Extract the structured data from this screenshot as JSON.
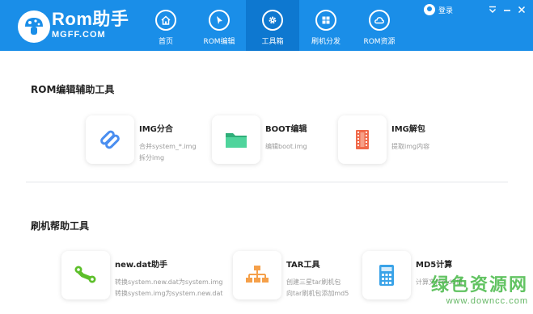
{
  "header": {
    "brand_name": "Rom助手",
    "brand_sub": "MGFF.COM",
    "login_label": "登录",
    "colors": {
      "bar": "#1a8ee8",
      "active_tab": "#0e78d0"
    },
    "nav": [
      {
        "label": "首页",
        "icon": "home-icon"
      },
      {
        "label": "ROM编辑",
        "icon": "cursor-icon"
      },
      {
        "label": "工具箱",
        "icon": "gear-icon",
        "active": true
      },
      {
        "label": "刷机分发",
        "icon": "grid-icon"
      },
      {
        "label": "ROM资源",
        "icon": "cloud-icon"
      }
    ]
  },
  "sections": {
    "rom_tools": {
      "title": "ROM编辑辅助工具",
      "tools": [
        {
          "name": "IMG分合",
          "desc1": "合并system_*.img",
          "desc2": "拆分img",
          "icon": "link-icon",
          "color": "#4a8ef0"
        },
        {
          "name": "BOOT编辑",
          "desc1": "编辑boot.img",
          "desc2": "",
          "icon": "folder-icon",
          "color": "#3dbf8a"
        },
        {
          "name": "IMG解包",
          "desc1": "提取img内容",
          "desc2": "",
          "icon": "film-icon",
          "color": "#f06a4a"
        }
      ]
    },
    "flash_tools": {
      "title": "刷机帮助工具",
      "tools": [
        {
          "name": "new.dat助手",
          "desc1": "转换system.new.dat为system.img",
          "desc2": "转换system.img为system.new.dat",
          "icon": "wrench-icon",
          "color": "#5cbf2a"
        },
        {
          "name": "TAR工具",
          "desc1": "创建三星tar刷机包",
          "desc2": "向tar刷机包添加md5",
          "icon": "hierarchy-icon",
          "color": "#f5a04a"
        },
        {
          "name": "MD5计算",
          "desc1": "计算文件md5值",
          "desc2": "",
          "icon": "calculator-icon",
          "color": "#3aa3e8"
        }
      ]
    }
  },
  "watermark": {
    "main": "绿色资源网",
    "sub": "www.downcc.com"
  }
}
